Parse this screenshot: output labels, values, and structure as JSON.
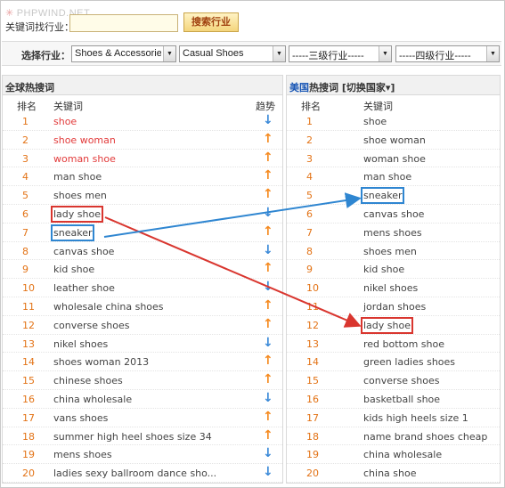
{
  "watermark": "PHPWIND.NET",
  "search": {
    "label": "关键词找行业：",
    "value": "",
    "button_label": "搜索行业"
  },
  "filter": {
    "label": "选择行业：",
    "level1": "Shoes & Accessorie",
    "level2": "Casual Shoes",
    "level3": "-----三级行业-----",
    "level4": "-----四级行业-----"
  },
  "global_panel": {
    "title": "全球热搜词",
    "col_rank": "排名",
    "col_keyword": "关键词",
    "col_trend": "趋势",
    "rows": [
      {
        "rank": "1",
        "keyword": "shoe",
        "trend": "down",
        "hot": true
      },
      {
        "rank": "2",
        "keyword": "shoe woman",
        "trend": "up",
        "hot": true
      },
      {
        "rank": "3",
        "keyword": "woman shoe",
        "trend": "up",
        "hot": true
      },
      {
        "rank": "4",
        "keyword": "man shoe",
        "trend": "up",
        "hot": false
      },
      {
        "rank": "5",
        "keyword": "shoes men",
        "trend": "up",
        "hot": false
      },
      {
        "rank": "6",
        "keyword": "lady shoe",
        "trend": "down",
        "hot": false
      },
      {
        "rank": "7",
        "keyword": "sneaker",
        "trend": "up",
        "hot": false
      },
      {
        "rank": "8",
        "keyword": "canvas shoe",
        "trend": "down",
        "hot": false
      },
      {
        "rank": "9",
        "keyword": "kid shoe",
        "trend": "up",
        "hot": false
      },
      {
        "rank": "10",
        "keyword": "leather shoe",
        "trend": "down",
        "hot": false
      },
      {
        "rank": "11",
        "keyword": "wholesale china shoes",
        "trend": "up",
        "hot": false
      },
      {
        "rank": "12",
        "keyword": "converse shoes",
        "trend": "up",
        "hot": false
      },
      {
        "rank": "13",
        "keyword": "nikel shoes",
        "trend": "down",
        "hot": false
      },
      {
        "rank": "14",
        "keyword": "shoes woman 2013",
        "trend": "up",
        "hot": false
      },
      {
        "rank": "15",
        "keyword": "chinese shoes",
        "trend": "up",
        "hot": false
      },
      {
        "rank": "16",
        "keyword": "china wholesale",
        "trend": "down",
        "hot": false
      },
      {
        "rank": "17",
        "keyword": "vans shoes",
        "trend": "up",
        "hot": false
      },
      {
        "rank": "18",
        "keyword": "summer high heel shoes size 34",
        "trend": "up",
        "hot": false
      },
      {
        "rank": "19",
        "keyword": "mens shoes",
        "trend": "down",
        "hot": false
      },
      {
        "rank": "20",
        "keyword": "ladies sexy ballroom dance sho...",
        "trend": "down",
        "hot": false
      }
    ]
  },
  "country_panel": {
    "country": "美国",
    "title_suffix": "热搜词",
    "switch_label": "[切换国家▾]",
    "col_rank": "排名",
    "col_keyword": "关键词",
    "rows": [
      {
        "rank": "1",
        "keyword": "shoe"
      },
      {
        "rank": "2",
        "keyword": "shoe woman"
      },
      {
        "rank": "3",
        "keyword": "woman shoe"
      },
      {
        "rank": "4",
        "keyword": "man shoe"
      },
      {
        "rank": "5",
        "keyword": "sneaker"
      },
      {
        "rank": "6",
        "keyword": "canvas shoe"
      },
      {
        "rank": "7",
        "keyword": "mens shoes"
      },
      {
        "rank": "8",
        "keyword": "shoes men"
      },
      {
        "rank": "9",
        "keyword": "kid shoe"
      },
      {
        "rank": "10",
        "keyword": "nikel shoes"
      },
      {
        "rank": "11",
        "keyword": "jordan shoes"
      },
      {
        "rank": "12",
        "keyword": "lady shoe"
      },
      {
        "rank": "13",
        "keyword": "red bottom shoe"
      },
      {
        "rank": "14",
        "keyword": "green ladies shoes"
      },
      {
        "rank": "15",
        "keyword": "converse shoes"
      },
      {
        "rank": "16",
        "keyword": "basketball shoe"
      },
      {
        "rank": "17",
        "keyword": "kids high heels size 1"
      },
      {
        "rank": "18",
        "keyword": "name brand shoes cheap"
      },
      {
        "rank": "19",
        "keyword": "china wholesale"
      },
      {
        "rank": "20",
        "keyword": "china shoe"
      }
    ]
  },
  "colors": {
    "rank": "#e37316",
    "hot_keyword": "#e23b3b",
    "trend_up": "#f58a1f",
    "trend_down": "#3b8ad8",
    "annotation_red": "#d9362f",
    "annotation_blue": "#2f86d1"
  },
  "icons": {
    "trend_up": "arrow-up-icon",
    "trend_down": "arrow-down-icon",
    "dropdown": "chevron-down-icon"
  }
}
